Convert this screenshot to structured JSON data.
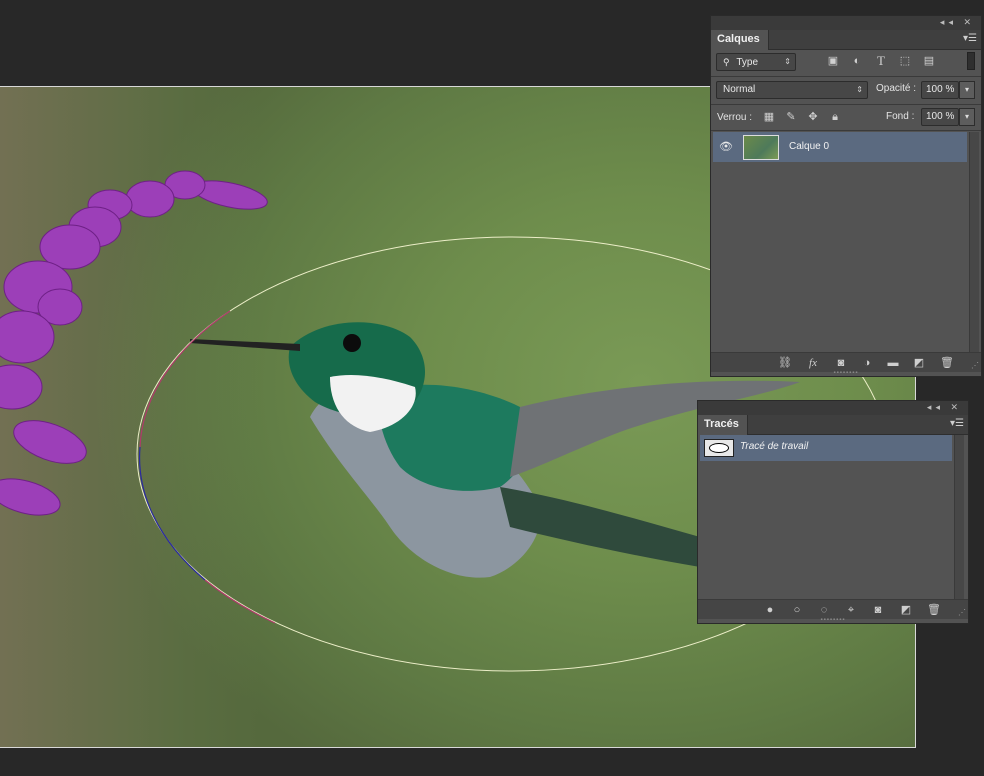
{
  "layers_panel": {
    "tab_label": "Calques",
    "filter_type": "Type",
    "blend_mode": "Normal",
    "opacity_label": "Opacité :",
    "opacity_value": "100 %",
    "lock_label": "Verrou :",
    "fill_label": "Fond :",
    "fill_value": "100 %",
    "layers": [
      {
        "name": "Calque 0",
        "visible": true,
        "selected": true
      }
    ],
    "footer_icons": [
      "link-icon",
      "fx-icon",
      "mask-icon",
      "adjustment-icon",
      "group-folder-icon",
      "new-layer-icon",
      "trash-icon"
    ],
    "fx_glyph": "fx"
  },
  "paths_panel": {
    "tab_label": "Tracés",
    "paths": [
      {
        "name": "Tracé de travail",
        "selected": true
      }
    ],
    "footer_icons": [
      "fill-path-icon",
      "stroke-path-icon",
      "load-selection-icon",
      "make-path-icon",
      "mask-icon",
      "new-path-icon",
      "trash-icon"
    ]
  },
  "colors": {
    "panel_bg": "#535353",
    "selected_row": "#5b6a80",
    "app_bg": "#282828"
  }
}
